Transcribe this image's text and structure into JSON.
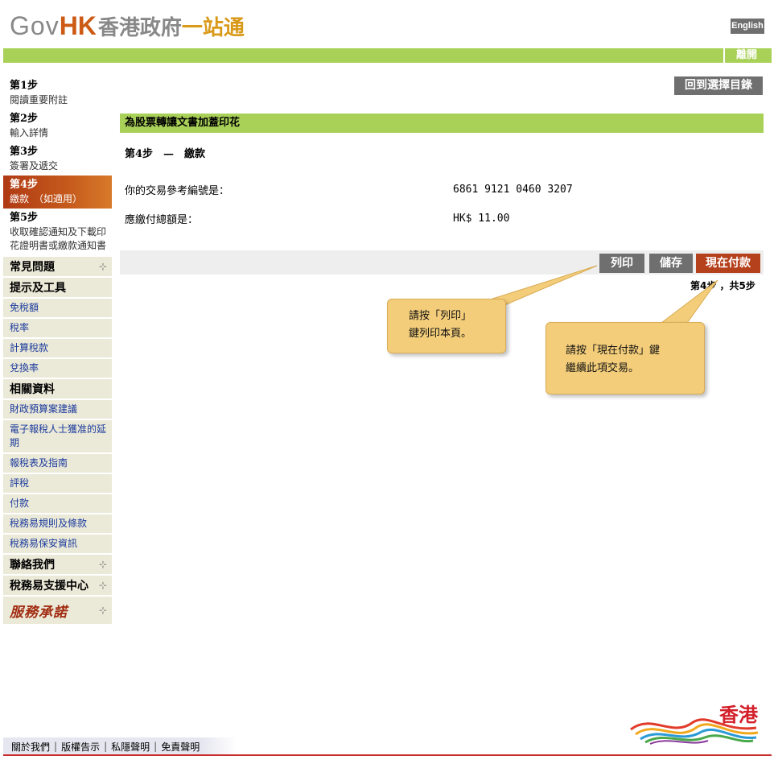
{
  "header": {
    "logo_gov": "Gov",
    "logo_hk": "HK",
    "logo_cn1": "香港政府",
    "logo_cn2": "一站通",
    "lang_label": "English",
    "leave_label": "離開"
  },
  "sidebar": {
    "steps": [
      {
        "title": "第1步",
        "desc": "閱讀重要附註"
      },
      {
        "title": "第2步",
        "desc": "輸入詳情"
      },
      {
        "title": "第3步",
        "desc": "簽署及遞交"
      },
      {
        "title": "第4步",
        "desc": "繳款　（如適用）"
      },
      {
        "title": "第5步",
        "desc": "收取確認通知及下載印花證明書或繳款通知書"
      }
    ],
    "faq": "常見問題",
    "tips_tools": "提示及工具",
    "tips_links": [
      "免稅額",
      "稅率",
      "計算稅款",
      "兌換率"
    ],
    "related": "相關資料",
    "related_links": [
      "財政預算案建議",
      "電子報稅人士獲准的延期",
      "報稅表及指南",
      "評稅",
      "付款",
      "稅務易規則及條款",
      "稅務易保安資訊"
    ],
    "contact": "聯絡我們",
    "support": "稅務易支援中心",
    "pledge": "服務承諾",
    "plus_glyph": "⊹"
  },
  "main": {
    "back_label": "回到選擇目錄",
    "page_title": "為股票轉讓文書加蓋印花",
    "step_title": "第4步　—　繳款",
    "ref_label": "你的交易參考編號是：",
    "ref_value": "6861 9121 0460 3207",
    "amount_label": "應繳付總額是：",
    "amount_value": "HK$ 11.00",
    "btn_print": "列印",
    "btn_save": "儲存",
    "btn_pay": "現在付款",
    "progress": "第4步 ，共5步"
  },
  "tips": {
    "print_tip_line1": "請按「列印」",
    "print_tip_line2": "鍵列印本頁。",
    "pay_tip_line1": "請按「現在付款」鍵",
    "pay_tip_line2": "繼續此項交易。"
  },
  "footer": {
    "links": [
      "關於我們",
      "版權告示",
      "私隱聲明",
      "免責聲明"
    ],
    "brand_text": "香港"
  },
  "colors": {
    "green_bar": "#a9d158",
    "grey_button": "#6f6f6f",
    "red_button": "#b5401c",
    "callout": "#f3cd7a"
  }
}
